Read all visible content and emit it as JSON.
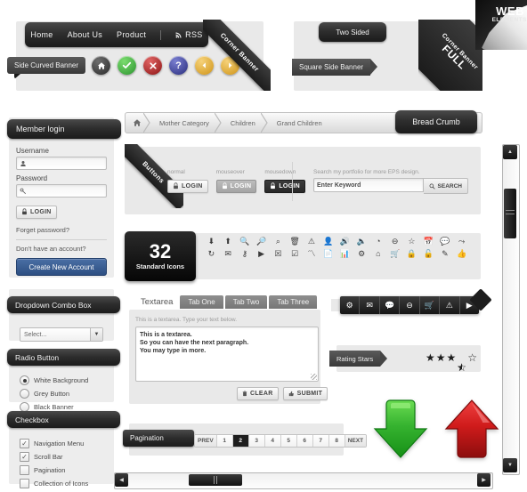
{
  "brand": {
    "line1": "WEB",
    "line2": "ELEMENTS"
  },
  "colors": {
    "panel_bg": "#e9e9e9",
    "dark_bar": "#1b1b1b",
    "accent_blue": "#2d4f82",
    "green": "#33aa33",
    "red": "#cc2222",
    "arrow_green": "#2eaa2e",
    "arrow_red": "#cf1b1b",
    "star": "#1c1c1c"
  },
  "topnav": {
    "items": [
      "Home",
      "About Us",
      "Product"
    ],
    "rss_label": "RSS",
    "rss_icon": "rss-icon"
  },
  "banners": {
    "corner_banner": "Corner Banner",
    "full_corner_banner_line1": "FULL",
    "full_corner_banner_line2": "Corner Banner",
    "side_curved": "Side Curved Banner",
    "two_sided": "Two Sided",
    "square_side": "Square Side Banner"
  },
  "circle_icons": [
    {
      "name": "home-icon",
      "glyph": "⌂",
      "color": "#3b3b3b"
    },
    {
      "name": "check-icon",
      "glyph": "✔",
      "color": "#3fae3f"
    },
    {
      "name": "close-icon",
      "glyph": "✖",
      "color": "#b82020"
    },
    {
      "name": "question-icon",
      "glyph": "?",
      "color": "#41459b"
    },
    {
      "name": "prev-icon",
      "glyph": "◀",
      "color": "#e4a92c"
    },
    {
      "name": "next-icon",
      "glyph": "▶",
      "color": "#e4a92c"
    }
  ],
  "login": {
    "title": "Member login",
    "username_label": "Username",
    "username_placeholder": "",
    "username_icon": "user-icon",
    "password_label": "Password",
    "password_placeholder": "",
    "password_icon": "key-icon",
    "login_button": "LOGIN",
    "login_icon": "lock-icon",
    "forgot": "Forget password?",
    "no_account": "Don't have an account?",
    "create_account": "Create New Account"
  },
  "breadcrumb": {
    "home_icon": "home-icon",
    "items": [
      "Mother Category",
      "Children",
      "Grand Children"
    ],
    "tag": "Bread Crumb"
  },
  "buttons_panel": {
    "ribbon": "Buttons",
    "states": [
      {
        "caption": "normal",
        "label": "LOGIN",
        "icon": "lock-icon"
      },
      {
        "caption": "mouseover",
        "label": "LOGIN",
        "icon": "lock-icon"
      },
      {
        "caption": "mousedown",
        "label": "LOGIN",
        "icon": "lock-icon"
      }
    ],
    "search_caption": "Search my portfolio for more EPS design.",
    "search_placeholder": "Enter Keyword",
    "search_button": "SEARCH",
    "search_icon": "search-icon"
  },
  "icons_panel": {
    "count": "32",
    "caption": "Standard Icons",
    "row1": [
      {
        "name": "arrow-down-icon",
        "glyph": "⬇"
      },
      {
        "name": "arrow-up-icon",
        "glyph": "⬆"
      },
      {
        "name": "zoom-in-icon",
        "glyph": "⌕"
      },
      {
        "name": "zoom-out-icon",
        "glyph": "⌕"
      },
      {
        "name": "search-icon",
        "glyph": "⌕"
      },
      {
        "name": "trash-icon",
        "glyph": "Ὕ1"
      },
      {
        "name": "warning-icon",
        "glyph": "⚠"
      },
      {
        "name": "user-icon",
        "glyph": "♟"
      },
      {
        "name": "volume-on-icon",
        "glyph": "ὐA"
      },
      {
        "name": "volume-off-icon",
        "glyph": "ὐ8"
      },
      {
        "name": "clock-icon",
        "glyph": "◴"
      },
      {
        "name": "block-icon",
        "glyph": "⊖"
      },
      {
        "name": "star-icon",
        "glyph": "☆"
      },
      {
        "name": "calendar-icon",
        "glyph": "Ὄ5"
      },
      {
        "name": "comment-icon",
        "glyph": "ὊC"
      },
      {
        "name": "redo-icon",
        "glyph": "⤷"
      }
    ],
    "row2": [
      {
        "name": "refresh-icon",
        "glyph": "↻"
      },
      {
        "name": "mail-icon",
        "glyph": "✉"
      },
      {
        "name": "key-icon",
        "glyph": "⚷"
      },
      {
        "name": "play-icon",
        "glyph": "▶"
      },
      {
        "name": "collapse-icon",
        "glyph": "⬇"
      },
      {
        "name": "expand-icon",
        "glyph": "⬆"
      },
      {
        "name": "rss-icon",
        "glyph": "⌁"
      },
      {
        "name": "document-icon",
        "glyph": "Ὄ4"
      },
      {
        "name": "chart-icon",
        "glyph": "ὌA"
      },
      {
        "name": "gear-icon",
        "glyph": "⚙"
      },
      {
        "name": "home-icon",
        "glyph": "⌂"
      },
      {
        "name": "cart-icon",
        "glyph": "Ὥ2"
      },
      {
        "name": "lock-closed-icon",
        "glyph": "ὑ2"
      },
      {
        "name": "lock-open-icon",
        "glyph": "ὑ3"
      },
      {
        "name": "edit-icon",
        "glyph": "✎"
      },
      {
        "name": "thumbs-up-icon",
        "glyph": "ὄD"
      }
    ]
  },
  "dropdown": {
    "title": "Dropdown Combo Box",
    "value": "Select...",
    "arrow_icon": "chevron-down-icon"
  },
  "radio": {
    "title": "Radio Button",
    "options": [
      {
        "label": "White Background",
        "checked": true
      },
      {
        "label": "Grey Button",
        "checked": false
      },
      {
        "label": "Black Banner",
        "checked": false
      }
    ]
  },
  "checkbox": {
    "title": "Checkbox",
    "options": [
      {
        "label": "Navigation Menu",
        "checked": true
      },
      {
        "label": "Scroll Bar",
        "checked": true
      },
      {
        "label": "Pagination",
        "checked": false
      },
      {
        "label": "Collection of Icons",
        "checked": false
      }
    ]
  },
  "textarea_panel": {
    "tabs": [
      {
        "label": "Textarea",
        "active": true
      },
      {
        "label": "Tab One",
        "active": false
      },
      {
        "label": "Tab Two",
        "active": false
      },
      {
        "label": "Tab Three",
        "active": false
      }
    ],
    "hint": "This is a textarea. Type your text below.",
    "value_line1": "This is a textarea.",
    "value_line2": "So you can have the next paragraph.",
    "value_line3": "You may type in more.",
    "clear_button": "CLEAR",
    "clear_icon": "trash-icon",
    "submit_button": "SUBMIT",
    "submit_icon": "thumbs-up-icon"
  },
  "toolbar": {
    "items": [
      {
        "name": "gear-icon",
        "glyph": "⚙"
      },
      {
        "name": "mail-icon",
        "glyph": "✉"
      },
      {
        "name": "comment-icon",
        "glyph": "ὊC"
      },
      {
        "name": "block-icon",
        "glyph": "⊖"
      },
      {
        "name": "cart-icon",
        "glyph": "Ὥ2"
      },
      {
        "name": "warning-icon",
        "glyph": "⚠"
      },
      {
        "name": "play-icon",
        "glyph": "▶"
      }
    ]
  },
  "rating": {
    "label": "Rating Stars",
    "value": 3.5,
    "max": 5,
    "full_glyph": "★",
    "half_glyph": "★",
    "empty_glyph": "☆"
  },
  "pagination": {
    "label": "Pagination",
    "prev": "PREV",
    "next": "NEXT",
    "pages": [
      "1",
      "2",
      "3",
      "4",
      "5",
      "6",
      "7",
      "8"
    ],
    "current": "2"
  },
  "big_arrows": [
    {
      "name": "arrow-down-large-icon",
      "direction": "down",
      "color": "#2eaa2e"
    },
    {
      "name": "arrow-up-large-icon",
      "direction": "up",
      "color": "#cf1b1b"
    }
  ],
  "scrollbars": {
    "vertical": {
      "up_icon": "triangle-up-icon",
      "down_icon": "triangle-down-icon"
    },
    "horizontal": {
      "left_icon": "triangle-left-icon",
      "right_icon": "triangle-right-icon"
    }
  }
}
